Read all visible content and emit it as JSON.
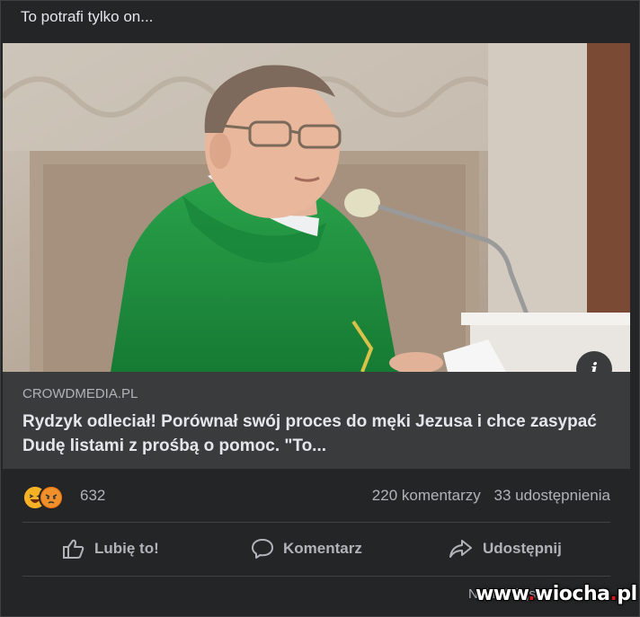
{
  "post": {
    "text": "To potrafi tylko on..."
  },
  "link": {
    "domain": "CROWDMEDIA.PL",
    "title": "Rydzyk odleciał! Porównał swój proces do męki Jezusa i chce zasypać Dudę listami z prośbą o pomoc. \"To..."
  },
  "reactions": {
    "count": "632",
    "icons": [
      "haha-icon",
      "angry-icon"
    ]
  },
  "stats": {
    "comments": "220 komentarzy",
    "shares": "33 udostępnienia"
  },
  "actions": {
    "like": "Lubię to!",
    "comment": "Komentarz",
    "share": "Udostępnij"
  },
  "footer": {
    "more": "Najtrafniejsze"
  },
  "watermark": {
    "part1": "www",
    "part2": "wiocha",
    "part3": "pl"
  },
  "colors": {
    "background": "#242526",
    "link_box": "#3a3b3c",
    "text": "#e4e6eb",
    "muted": "#b0b3b8",
    "vestment": "#1f8a3a"
  }
}
